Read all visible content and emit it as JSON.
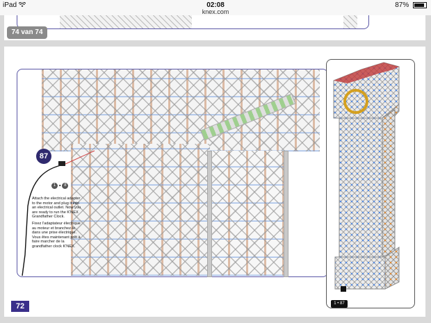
{
  "status_bar": {
    "device": "iPad",
    "wifi_icon": "wifi-icon",
    "time": "02:08",
    "url": "knex.com",
    "battery_text": "87%",
    "battery_level": 0.87
  },
  "viewer": {
    "page_counter": "74 van 74"
  },
  "page": {
    "page_number": "72",
    "step_number": "87",
    "small_icon_labels": [
      "1",
      "8"
    ],
    "instructions_en": "Attach the electrical adapter to the motor and plug it into an electrical outlet. Now you are ready to run the K'NEX Grandfather Clock.",
    "instructions_fr": "Fixez l'adaptateur électrique au moteur et branchez-le dans une prise électrique. Vous êtes maintenant prêt à faire marcher de la grandfather clock K'NEX.",
    "clock_badge_labels": [
      "1",
      "87"
    ]
  },
  "colors": {
    "frame_purple": "#5a57a6",
    "page_badge": "#3a2f8a",
    "step_badge": "#2f2a6e",
    "lattice_blue": "#5a8cdc",
    "lattice_orange": "#c88c64"
  }
}
